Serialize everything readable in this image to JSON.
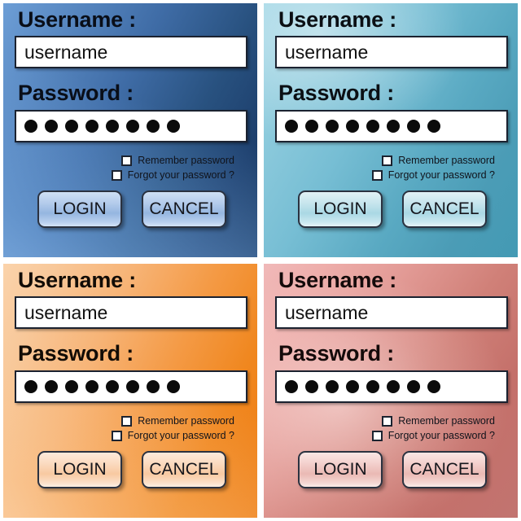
{
  "form": {
    "username_label": "Username :",
    "username_value": "username",
    "password_label": "Password :",
    "password_mask_count": 8,
    "remember_label": "Remember password",
    "forgot_label": "Forgot your password ?",
    "login_label": "LOGIN",
    "cancel_label": "CANCEL"
  },
  "panels": [
    {
      "id": "panel-blue",
      "theme": "blue",
      "accent_light": "#6d9ed6",
      "accent_dark": "#173760",
      "username_label": "Username :",
      "username_value": "username",
      "password_label": "Password :",
      "password_mask": "●●●●●●●●",
      "remember_label": "Remember password",
      "forgot_label": "Forgot your password ?",
      "login_label": "LOGIN",
      "cancel_label": "CANCEL"
    },
    {
      "id": "panel-teal",
      "theme": "teal",
      "accent_light": "#9ad3e4",
      "accent_dark": "#439ab4",
      "username_label": "Username :",
      "username_value": "username",
      "password_label": "Password :",
      "password_mask": "●●●●●●●●",
      "remember_label": "Remember password",
      "forgot_label": "Forgot your password ?",
      "login_label": "LOGIN",
      "cancel_label": "CANCEL"
    },
    {
      "id": "panel-orange",
      "theme": "orange",
      "accent_light": "#fbd3ab",
      "accent_dark": "#ee7d12",
      "username_label": "Username :",
      "username_value": "username",
      "password_label": "Password :",
      "password_mask": "●●●●●●●●",
      "remember_label": "Remember password",
      "forgot_label": "Forgot your password ?",
      "login_label": "LOGIN",
      "cancel_label": "CANCEL"
    },
    {
      "id": "panel-red",
      "theme": "red",
      "accent_light": "#f0b9b9",
      "accent_dark": "#c27470",
      "username_label": "Username :",
      "username_value": "username",
      "password_label": "Password :",
      "password_mask": "●●●●●●●●",
      "remember_label": "Remember password",
      "forgot_label": "Forgot your password ?",
      "login_label": "LOGIN",
      "cancel_label": "CANCEL"
    }
  ]
}
